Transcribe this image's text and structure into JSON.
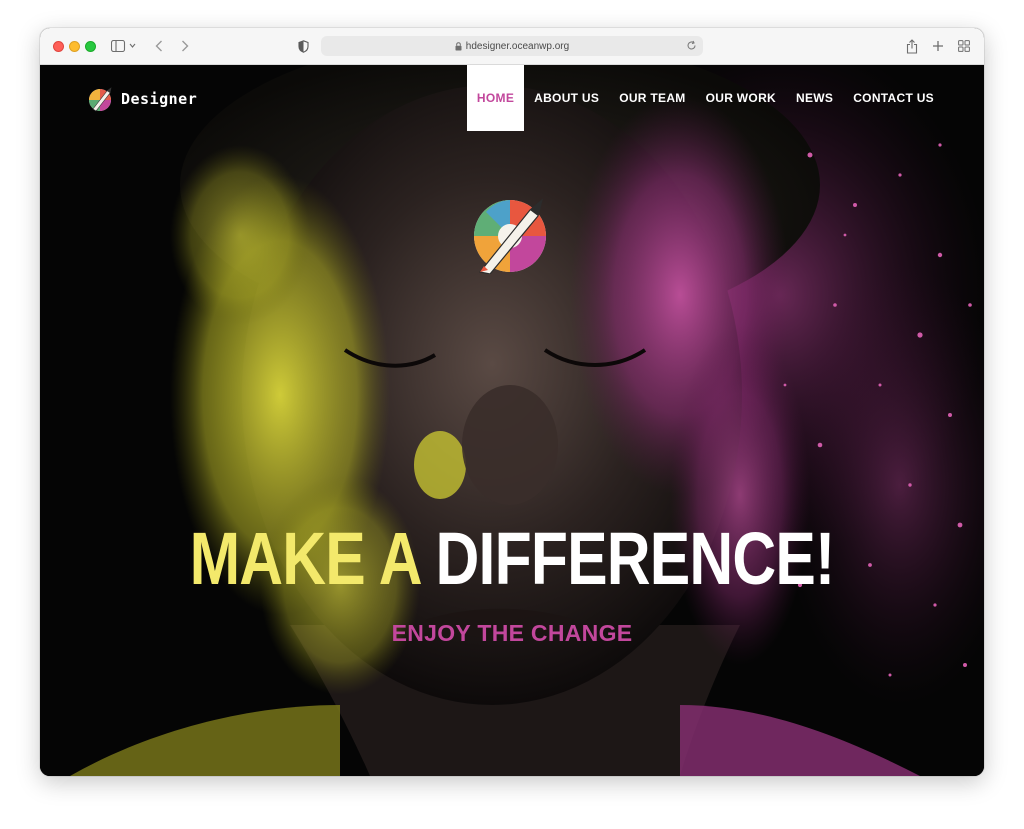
{
  "browser": {
    "url": "hdesigner.oceanwp.org",
    "icons": [
      "close-window",
      "minimize-window",
      "zoom-window",
      "sidebar",
      "chevron-down",
      "back",
      "forward",
      "shield",
      "lock",
      "reload",
      "share",
      "new-tab",
      "tab-overview"
    ]
  },
  "site": {
    "logo_text": "Designer",
    "nav": [
      {
        "label": "HOME",
        "active": true
      },
      {
        "label": "ABOUT US",
        "active": false
      },
      {
        "label": "OUR TEAM",
        "active": false
      },
      {
        "label": "OUR WORK",
        "active": false
      },
      {
        "label": "NEWS",
        "active": false
      },
      {
        "label": "CONTACT US",
        "active": false
      }
    ]
  },
  "hero": {
    "headline_part1": "MAKE A",
    "headline_part2": "DIFFERENCE!",
    "subheadline": "ENJOY THE CHANGE"
  },
  "colors": {
    "accent_pink": "#c2479c",
    "accent_yellow": "#f3e96b",
    "background": "#050505"
  }
}
